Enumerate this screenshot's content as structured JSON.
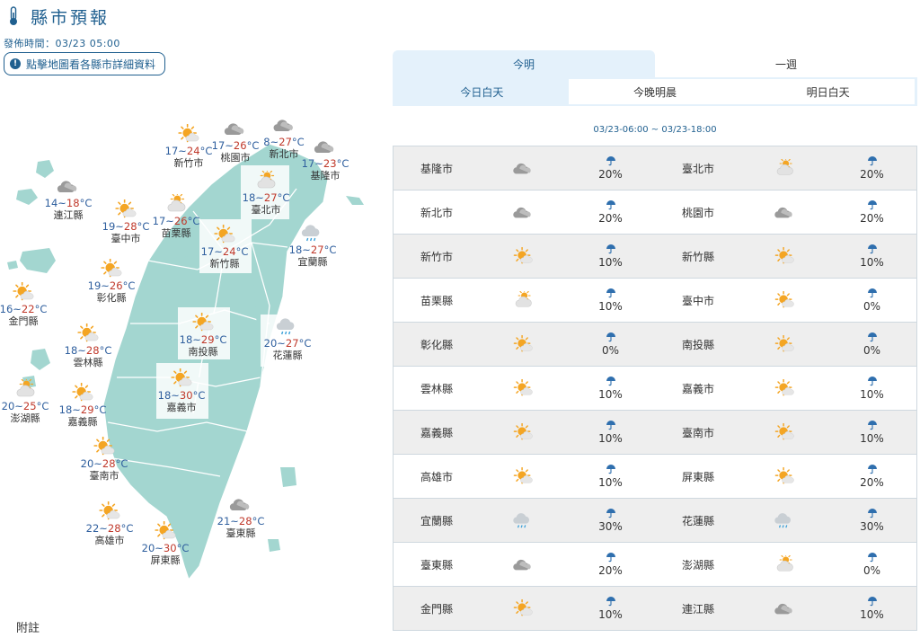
{
  "header": {
    "title": "縣市預報",
    "issue_time": "發佈時間：03/23 05:00",
    "notice": "點擊地圖看各縣市詳細資料"
  },
  "footnote": "附註",
  "colors": {
    "accent": "#1f5f8f",
    "tab_bg": "#e4f1fb",
    "map_land": "#a3d6d0",
    "low_temp": "#2f5f9e",
    "high_temp": "#c0392b"
  },
  "tabs": {
    "top": [
      {
        "label": "今明",
        "active": true
      },
      {
        "label": "一週",
        "active": false
      }
    ],
    "sub": [
      {
        "label": "今日白天",
        "active": true
      },
      {
        "label": "今晚明晨",
        "active": false
      },
      {
        "label": "明日白天",
        "active": false
      }
    ]
  },
  "time_range": "03/23-06:00 ~ 03/23-18:00",
  "map_cities": [
    {
      "name": "新竹市",
      "lo": "17",
      "hi": "24",
      "unit": "°C",
      "icon": "sun-cloud"
    },
    {
      "name": "桃園市",
      "lo": "17",
      "hi": "26",
      "unit": "°C",
      "icon": "cloud"
    },
    {
      "name": "新北市",
      "lo": "8",
      "hi": "27",
      "unit": "°C",
      "icon": "cloud"
    },
    {
      "name": "基隆市",
      "lo": "17",
      "hi": "23",
      "unit": "°C",
      "icon": "cloud"
    },
    {
      "name": "臺北市",
      "lo": "18",
      "hi": "27",
      "unit": "°C",
      "icon": "cloud-sun"
    },
    {
      "name": "連江縣",
      "lo": "14",
      "hi": "18",
      "unit": "°C",
      "icon": "cloud"
    },
    {
      "name": "臺中市",
      "lo": "19",
      "hi": "28",
      "unit": "°C",
      "icon": "sun-cloud"
    },
    {
      "name": "苗栗縣",
      "lo": "17",
      "hi": "26",
      "unit": "°C",
      "icon": "cloud-sun"
    },
    {
      "name": "新竹縣",
      "lo": "17",
      "hi": "24",
      "unit": "°C",
      "icon": "sun-cloud"
    },
    {
      "name": "宜蘭縣",
      "lo": "18",
      "hi": "27",
      "unit": "°C",
      "icon": "rain-cloud"
    },
    {
      "name": "彰化縣",
      "lo": "19",
      "hi": "26",
      "unit": "°C",
      "icon": "sun-cloud"
    },
    {
      "name": "金門縣",
      "lo": "16",
      "hi": "22",
      "unit": "°C",
      "icon": "sun-cloud"
    },
    {
      "name": "南投縣",
      "lo": "18",
      "hi": "29",
      "unit": "°C",
      "icon": "sun-cloud"
    },
    {
      "name": "花蓮縣",
      "lo": "20",
      "hi": "27",
      "unit": "°C",
      "icon": "rain-cloud"
    },
    {
      "name": "雲林縣",
      "lo": "18",
      "hi": "28",
      "unit": "°C",
      "icon": "sun-cloud"
    },
    {
      "name": "嘉義市",
      "lo": "18",
      "hi": "30",
      "unit": "°C",
      "icon": "sun-cloud"
    },
    {
      "name": "澎湖縣",
      "lo": "20",
      "hi": "25",
      "unit": "°C",
      "icon": "cloud-sun"
    },
    {
      "name": "嘉義縣",
      "lo": "18",
      "hi": "29",
      "unit": "°C",
      "icon": "sun-cloud"
    },
    {
      "name": "臺南市",
      "lo": "20",
      "hi": "28",
      "unit": "°C",
      "icon": "sun-cloud"
    },
    {
      "name": "高雄市",
      "lo": "22",
      "hi": "28",
      "unit": "°C",
      "icon": "sun-cloud"
    },
    {
      "name": "屏東縣",
      "lo": "20",
      "hi": "30",
      "unit": "°C",
      "icon": "sun-cloud"
    },
    {
      "name": "臺東縣",
      "lo": "21",
      "hi": "28",
      "unit": "°C",
      "icon": "cloud"
    }
  ],
  "table": [
    [
      {
        "name": "基隆市",
        "icon": "cloud",
        "pop": "20%"
      },
      {
        "name": "臺北市",
        "icon": "cloud-sun",
        "pop": "20%"
      }
    ],
    [
      {
        "name": "新北市",
        "icon": "cloud",
        "pop": "20%"
      },
      {
        "name": "桃園市",
        "icon": "cloud",
        "pop": "20%"
      }
    ],
    [
      {
        "name": "新竹市",
        "icon": "sun-cloud",
        "pop": "10%"
      },
      {
        "name": "新竹縣",
        "icon": "sun-cloud",
        "pop": "10%"
      }
    ],
    [
      {
        "name": "苗栗縣",
        "icon": "cloud-sun",
        "pop": "10%"
      },
      {
        "name": "臺中市",
        "icon": "sun-cloud",
        "pop": "0%"
      }
    ],
    [
      {
        "name": "彰化縣",
        "icon": "sun-cloud",
        "pop": "0%"
      },
      {
        "name": "南投縣",
        "icon": "sun-cloud",
        "pop": "0%"
      }
    ],
    [
      {
        "name": "雲林縣",
        "icon": "sun-cloud",
        "pop": "10%"
      },
      {
        "name": "嘉義市",
        "icon": "sun-cloud",
        "pop": "10%"
      }
    ],
    [
      {
        "name": "嘉義縣",
        "icon": "sun-cloud",
        "pop": "10%"
      },
      {
        "name": "臺南市",
        "icon": "sun-cloud",
        "pop": "10%"
      }
    ],
    [
      {
        "name": "高雄市",
        "icon": "sun-cloud",
        "pop": "10%"
      },
      {
        "name": "屏東縣",
        "icon": "sun-cloud",
        "pop": "20%"
      }
    ],
    [
      {
        "name": "宜蘭縣",
        "icon": "rain-cloud",
        "pop": "30%"
      },
      {
        "name": "花蓮縣",
        "icon": "rain-cloud",
        "pop": "30%"
      }
    ],
    [
      {
        "name": "臺東縣",
        "icon": "cloud",
        "pop": "20%"
      },
      {
        "name": "澎湖縣",
        "icon": "cloud-sun",
        "pop": "0%"
      }
    ],
    [
      {
        "name": "金門縣",
        "icon": "sun-cloud",
        "pop": "10%"
      },
      {
        "name": "連江縣",
        "icon": "cloud",
        "pop": "10%"
      }
    ]
  ]
}
